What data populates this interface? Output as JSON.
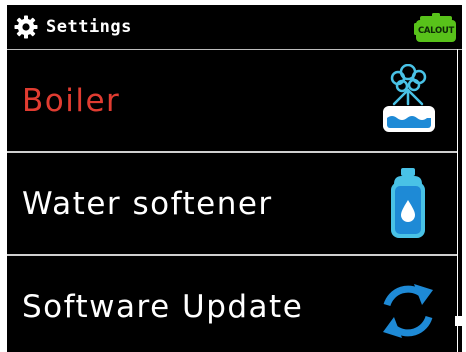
{
  "header": {
    "title": "Settings",
    "brand": "CALOUT",
    "gear_icon": "gear-icon",
    "brand_icon": "calout-kettle-logo"
  },
  "menu": {
    "items": [
      {
        "label": "Boiler",
        "icon": "boiler-icon",
        "color": "#e03c31",
        "selected": true
      },
      {
        "label": "Water softener",
        "icon": "water-softener-icon",
        "color": "#ffffff",
        "selected": false
      },
      {
        "label": "Software Update",
        "icon": "software-update-icon",
        "color": "#ffffff",
        "selected": false
      }
    ]
  },
  "colors": {
    "background": "#000000",
    "selected_text": "#e03c31",
    "text": "#ffffff",
    "accent_blue": "#1e8ad6",
    "water_blue": "#49c2e6",
    "brand_green": "#58c21a"
  }
}
